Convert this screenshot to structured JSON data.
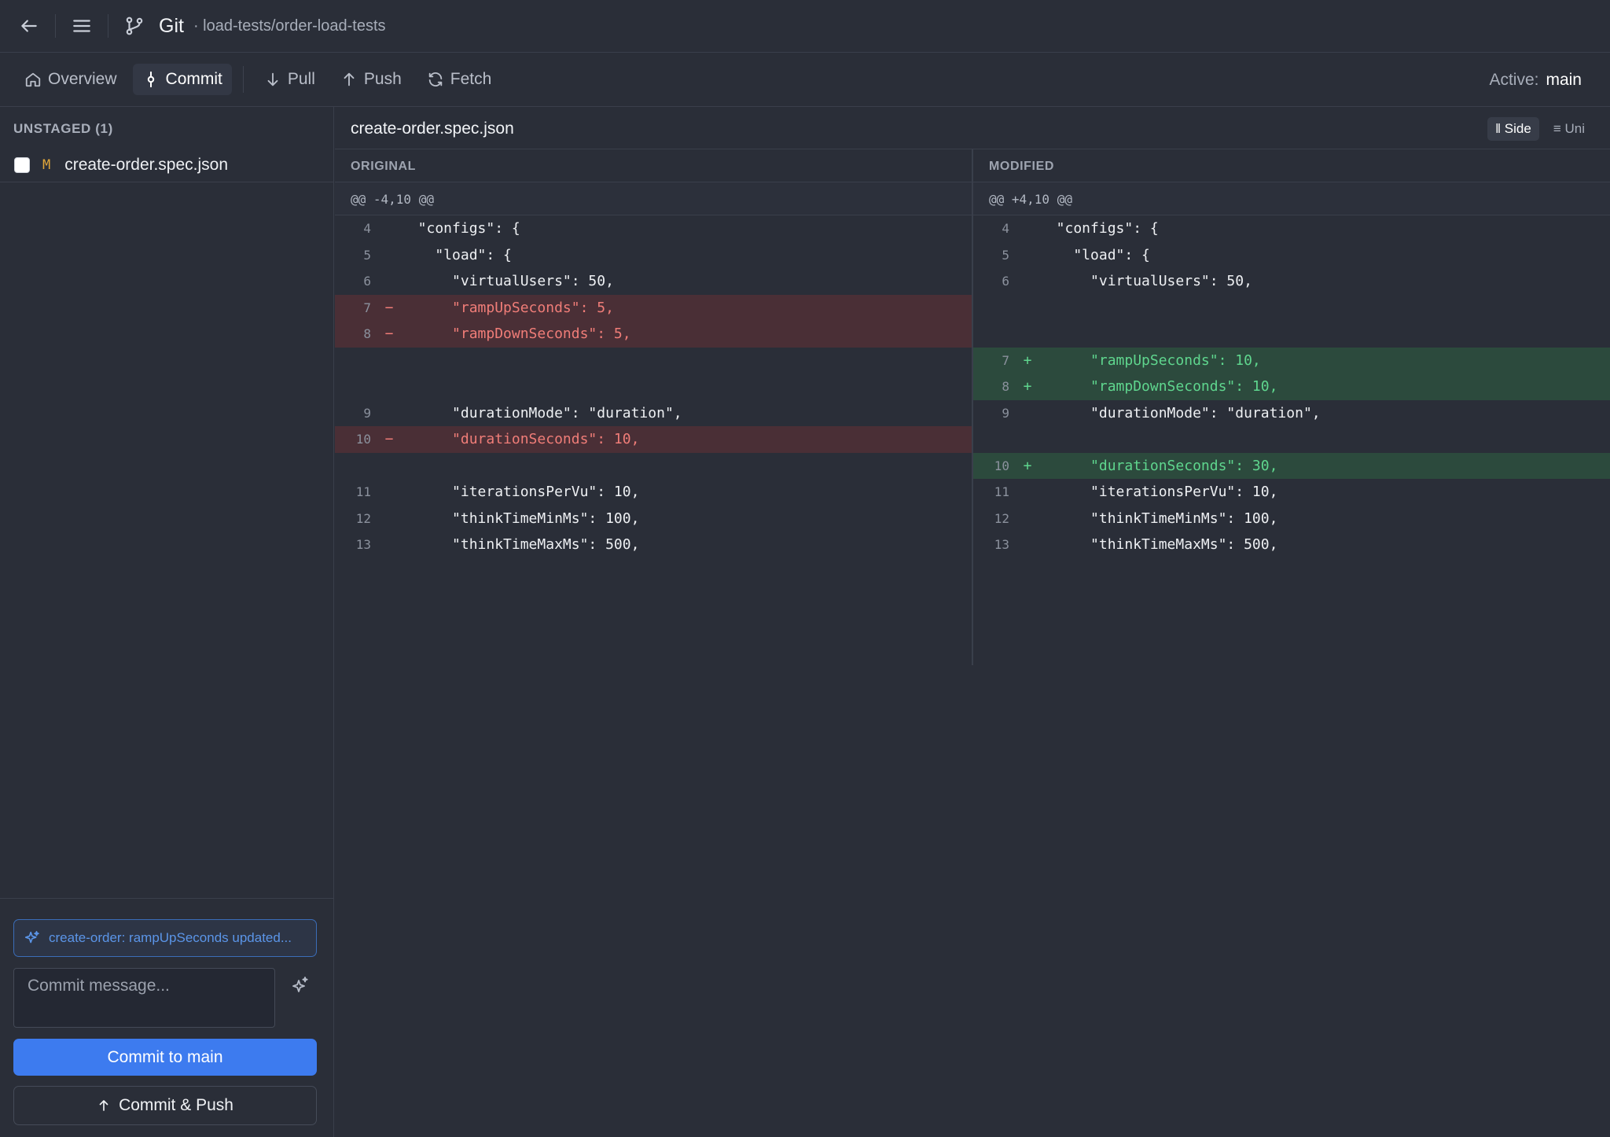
{
  "titlebar": {
    "app_name": "Git",
    "repo_path": "· load-tests/order-load-tests"
  },
  "tabs": [
    {
      "label": "Overview",
      "icon": "home-icon"
    },
    {
      "label": "Commit",
      "icon": "commit-icon",
      "active": true
    },
    {
      "label": "Pull",
      "icon": "arrow-down-icon"
    },
    {
      "label": "Push",
      "icon": "arrow-up-icon"
    },
    {
      "label": "Fetch",
      "icon": "refresh-icon"
    }
  ],
  "active_branch": {
    "label": "Active:",
    "value": "main"
  },
  "sidebar": {
    "section_title": "UNSTAGED (1)",
    "files": [
      {
        "status": "M",
        "name": "create-order.spec.json"
      }
    ],
    "suggestion": "create-order: rampUpSeconds updated...",
    "commit_placeholder": "Commit message...",
    "commit_button": "Commit to main",
    "commit_push_button": "Commit & Push"
  },
  "diff": {
    "filename": "create-order.spec.json",
    "view_side": "‖ Side",
    "view_unified": "≡ Uni",
    "original_head": "ORIGINAL",
    "modified_head": "MODIFIED",
    "original_hunk": "@@ -4,10 @@",
    "modified_hunk": "@@ +4,10 @@",
    "original_lines": [
      {
        "n": "4",
        "sign": "",
        "type": "ctx",
        "code": "  \"configs\": {"
      },
      {
        "n": "5",
        "sign": "",
        "type": "ctx",
        "code": "    \"load\": {"
      },
      {
        "n": "6",
        "sign": "",
        "type": "ctx",
        "code": "      \"virtualUsers\": 50,"
      },
      {
        "n": "7",
        "sign": "−",
        "type": "del",
        "code": "      \"rampUpSeconds\": 5,"
      },
      {
        "n": "8",
        "sign": "−",
        "type": "del",
        "code": "      \"rampDownSeconds\": 5,"
      },
      {
        "n": "",
        "sign": "",
        "type": "blank",
        "code": ""
      },
      {
        "n": "",
        "sign": "",
        "type": "blank",
        "code": ""
      },
      {
        "n": "9",
        "sign": "",
        "type": "ctx",
        "code": "      \"durationMode\": \"duration\","
      },
      {
        "n": "10",
        "sign": "−",
        "type": "del",
        "code": "      \"durationSeconds\": 10,"
      },
      {
        "n": "",
        "sign": "",
        "type": "blank",
        "code": ""
      },
      {
        "n": "11",
        "sign": "",
        "type": "ctx",
        "code": "      \"iterationsPerVu\": 10,"
      },
      {
        "n": "12",
        "sign": "",
        "type": "ctx",
        "code": "      \"thinkTimeMinMs\": 100,"
      },
      {
        "n": "13",
        "sign": "",
        "type": "ctx",
        "code": "      \"thinkTimeMaxMs\": 500,"
      }
    ],
    "modified_lines": [
      {
        "n": "4",
        "sign": "",
        "type": "ctx",
        "code": "  \"configs\": {"
      },
      {
        "n": "5",
        "sign": "",
        "type": "ctx",
        "code": "    \"load\": {"
      },
      {
        "n": "6",
        "sign": "",
        "type": "ctx",
        "code": "      \"virtualUsers\": 50,"
      },
      {
        "n": "",
        "sign": "",
        "type": "blank",
        "code": ""
      },
      {
        "n": "",
        "sign": "",
        "type": "blank",
        "code": ""
      },
      {
        "n": "7",
        "sign": "+",
        "type": "add",
        "code": "      \"rampUpSeconds\": 10,"
      },
      {
        "n": "8",
        "sign": "+",
        "type": "add",
        "code": "      \"rampDownSeconds\": 10,"
      },
      {
        "n": "9",
        "sign": "",
        "type": "ctx",
        "code": "      \"durationMode\": \"duration\","
      },
      {
        "n": "",
        "sign": "",
        "type": "blank",
        "code": ""
      },
      {
        "n": "10",
        "sign": "+",
        "type": "add",
        "code": "      \"durationSeconds\": 30,"
      },
      {
        "n": "11",
        "sign": "",
        "type": "ctx",
        "code": "      \"iterationsPerVu\": 10,"
      },
      {
        "n": "12",
        "sign": "",
        "type": "ctx",
        "code": "      \"thinkTimeMinMs\": 100,"
      },
      {
        "n": "13",
        "sign": "",
        "type": "ctx",
        "code": "      \"thinkTimeMaxMs\": 500,"
      }
    ]
  },
  "colors": {
    "background": "#2a2e38",
    "accent": "#3d7bef",
    "deleted": "#f07d78",
    "added": "#5fd68e",
    "modified_status": "#e0a63a"
  }
}
